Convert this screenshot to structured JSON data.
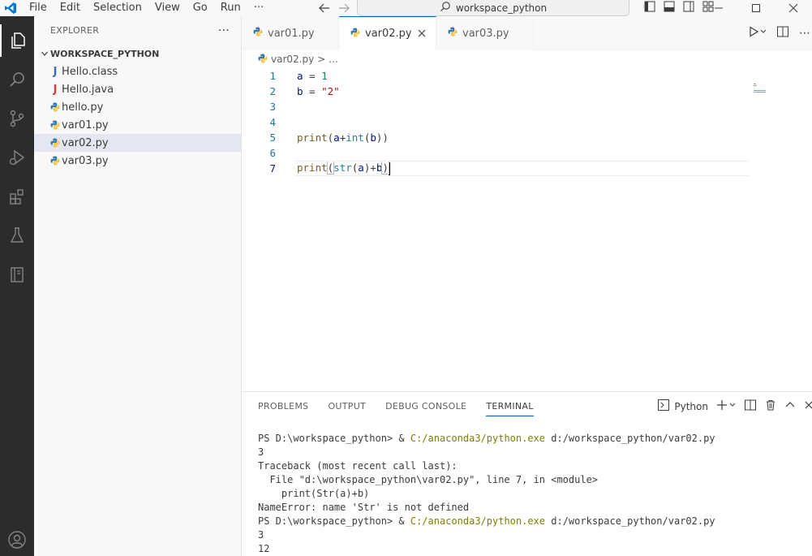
{
  "titlebar": {
    "menu": [
      "File",
      "Edit",
      "Selection",
      "View",
      "Go",
      "Run",
      "···"
    ],
    "search_text": "workspace_python"
  },
  "activity_bar": {
    "items": [
      "explorer-icon",
      "search-icon",
      "source-control-icon",
      "run-debug-icon",
      "extensions-icon",
      "testing-icon",
      "notebook-icon",
      "account-icon"
    ]
  },
  "sidebar": {
    "title": "EXPLORER",
    "more": "···",
    "folder": "WORKSPACE_PYTHON",
    "files": [
      {
        "name": "Hello.class",
        "icon": "J",
        "color": "#3c6db5"
      },
      {
        "name": "Hello.java",
        "icon": "J",
        "color": "#cc3e44"
      },
      {
        "name": "hello.py",
        "icon": "python"
      },
      {
        "name": "var01.py",
        "icon": "python"
      },
      {
        "name": "var02.py",
        "icon": "python"
      },
      {
        "name": "var03.py",
        "icon": "python"
      }
    ]
  },
  "editor": {
    "tabs": [
      {
        "label": "var01.py"
      },
      {
        "label": "var02.py"
      },
      {
        "label": "var03.py"
      }
    ],
    "breadcrumb": {
      "file": "var02.py",
      "sep": ">",
      "rest": "..."
    },
    "lines": [
      {
        "n": "1",
        "text": "a = 1"
      },
      {
        "n": "2",
        "text": "b = \"2\""
      },
      {
        "n": "3",
        "text": ""
      },
      {
        "n": "4",
        "text": ""
      },
      {
        "n": "5",
        "text": "print(a+int(b))"
      },
      {
        "n": "6",
        "text": ""
      },
      {
        "n": "7",
        "text": "print(str(a)+b)"
      }
    ]
  },
  "panel": {
    "tabs": [
      "PROBLEMS",
      "OUTPUT",
      "DEBUG CONSOLE",
      "TERMINAL"
    ],
    "active_tab": "TERMINAL",
    "terminal_name": "Python",
    "terminal": [
      {
        "prompt": "PS D:\\workspace_python> & ",
        "exe": "C:/anaconda3/python.exe",
        "arg": " d:/workspace_python/var02.py"
      },
      {
        "text": "3"
      },
      {
        "text": "Traceback (most recent call last):"
      },
      {
        "text": "  File \"d:\\workspace_python\\var02.py\", line 7, in <module>"
      },
      {
        "text": "    print(Str(a)+b)"
      },
      {
        "text": "NameError: name 'Str' is not defined"
      },
      {
        "prompt": "PS D:\\workspace_python> & ",
        "exe": "C:/anaconda3/python.exe",
        "arg": " d:/workspace_python/var02.py"
      },
      {
        "text": "3"
      },
      {
        "text": "12"
      }
    ]
  }
}
